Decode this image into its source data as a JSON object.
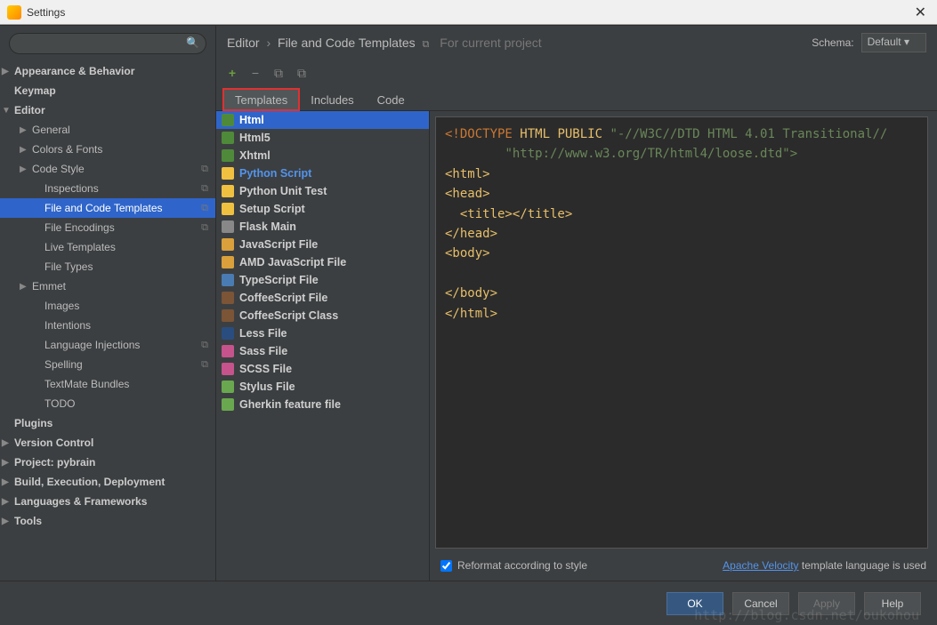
{
  "window": {
    "title": "Settings"
  },
  "search": {
    "placeholder": ""
  },
  "sidebar": {
    "items": [
      {
        "label": "Appearance & Behavior",
        "lvl": 0,
        "arrow": "▶"
      },
      {
        "label": "Keymap",
        "lvl": 0,
        "arrow": ""
      },
      {
        "label": "Editor",
        "lvl": 0,
        "arrow": "▼"
      },
      {
        "label": "General",
        "lvl": 1,
        "arrow": "▶"
      },
      {
        "label": "Colors & Fonts",
        "lvl": 1,
        "arrow": "▶"
      },
      {
        "label": "Code Style",
        "lvl": 1,
        "arrow": "▶",
        "badge": "⧉"
      },
      {
        "label": "Inspections",
        "lvl": 2,
        "arrow": "",
        "badge": "⧉"
      },
      {
        "label": "File and Code Templates",
        "lvl": 2,
        "arrow": "",
        "badge": "⧉",
        "selected": true
      },
      {
        "label": "File Encodings",
        "lvl": 2,
        "arrow": "",
        "badge": "⧉"
      },
      {
        "label": "Live Templates",
        "lvl": 2,
        "arrow": ""
      },
      {
        "label": "File Types",
        "lvl": 2,
        "arrow": ""
      },
      {
        "label": "Emmet",
        "lvl": 1,
        "arrow": "▶"
      },
      {
        "label": "Images",
        "lvl": 2,
        "arrow": ""
      },
      {
        "label": "Intentions",
        "lvl": 2,
        "arrow": ""
      },
      {
        "label": "Language Injections",
        "lvl": 2,
        "arrow": "",
        "badge": "⧉"
      },
      {
        "label": "Spelling",
        "lvl": 2,
        "arrow": "",
        "badge": "⧉"
      },
      {
        "label": "TextMate Bundles",
        "lvl": 2,
        "arrow": ""
      },
      {
        "label": "TODO",
        "lvl": 2,
        "arrow": ""
      },
      {
        "label": "Plugins",
        "lvl": 0,
        "arrow": ""
      },
      {
        "label": "Version Control",
        "lvl": 0,
        "arrow": "▶"
      },
      {
        "label": "Project: pybrain",
        "lvl": 0,
        "arrow": "▶"
      },
      {
        "label": "Build, Execution, Deployment",
        "lvl": 0,
        "arrow": "▶"
      },
      {
        "label": "Languages & Frameworks",
        "lvl": 0,
        "arrow": "▶"
      },
      {
        "label": "Tools",
        "lvl": 0,
        "arrow": "▶"
      }
    ]
  },
  "breadcrumb": {
    "root": "Editor",
    "leaf": "File and Code Templates",
    "note": "For current project"
  },
  "schema": {
    "label": "Schema:",
    "value": "Default"
  },
  "toolbar": {
    "add": "+",
    "remove": "−",
    "copy": "⧉",
    "paste": "⧉"
  },
  "tabs": [
    {
      "label": "Templates",
      "active": true,
      "highlight": true
    },
    {
      "label": "Includes"
    },
    {
      "label": "Code"
    }
  ],
  "templates": [
    {
      "label": "Html",
      "icon": "ic-html",
      "selected": true
    },
    {
      "label": "Html5",
      "icon": "ic-html"
    },
    {
      "label": "Xhtml",
      "icon": "ic-html"
    },
    {
      "label": "Python Script",
      "icon": "ic-py",
      "internal": true
    },
    {
      "label": "Python Unit Test",
      "icon": "ic-py"
    },
    {
      "label": "Setup Script",
      "icon": "ic-py"
    },
    {
      "label": "Flask Main",
      "icon": "ic-flask"
    },
    {
      "label": "JavaScript File",
      "icon": "ic-js"
    },
    {
      "label": "AMD JavaScript File",
      "icon": "ic-js"
    },
    {
      "label": "TypeScript File",
      "icon": "ic-ts"
    },
    {
      "label": "CoffeeScript File",
      "icon": "ic-coffee"
    },
    {
      "label": "CoffeeScript Class",
      "icon": "ic-coffee"
    },
    {
      "label": "Less File",
      "icon": "ic-less"
    },
    {
      "label": "Sass File",
      "icon": "ic-sass"
    },
    {
      "label": "SCSS File",
      "icon": "ic-sass"
    },
    {
      "label": "Stylus File",
      "icon": "ic-stylus"
    },
    {
      "label": "Gherkin feature file",
      "icon": "ic-gherkin"
    }
  ],
  "code": {
    "line1a": "<!DOCTYPE ",
    "line1b": "HTML PUBLIC ",
    "line1c": "\"-//W3C//DTD HTML 4.01 Transitional//",
    "line2": "\"http://www.w3.org/TR/html4/loose.dtd\">",
    "html_open": "<html>",
    "head_open": "<head>",
    "title": "<title></title>",
    "head_close": "</head>",
    "body_open": "<body>",
    "body_close": "</body>",
    "html_close": "</html>"
  },
  "footer": {
    "reformat": "Reformat according to style",
    "link": "Apache Velocity",
    "note_tail": " template language is used"
  },
  "buttons": {
    "ok": "OK",
    "cancel": "Cancel",
    "apply": "Apply",
    "help": "Help"
  },
  "watermark": "http://blog.csdn.net/oukohou"
}
